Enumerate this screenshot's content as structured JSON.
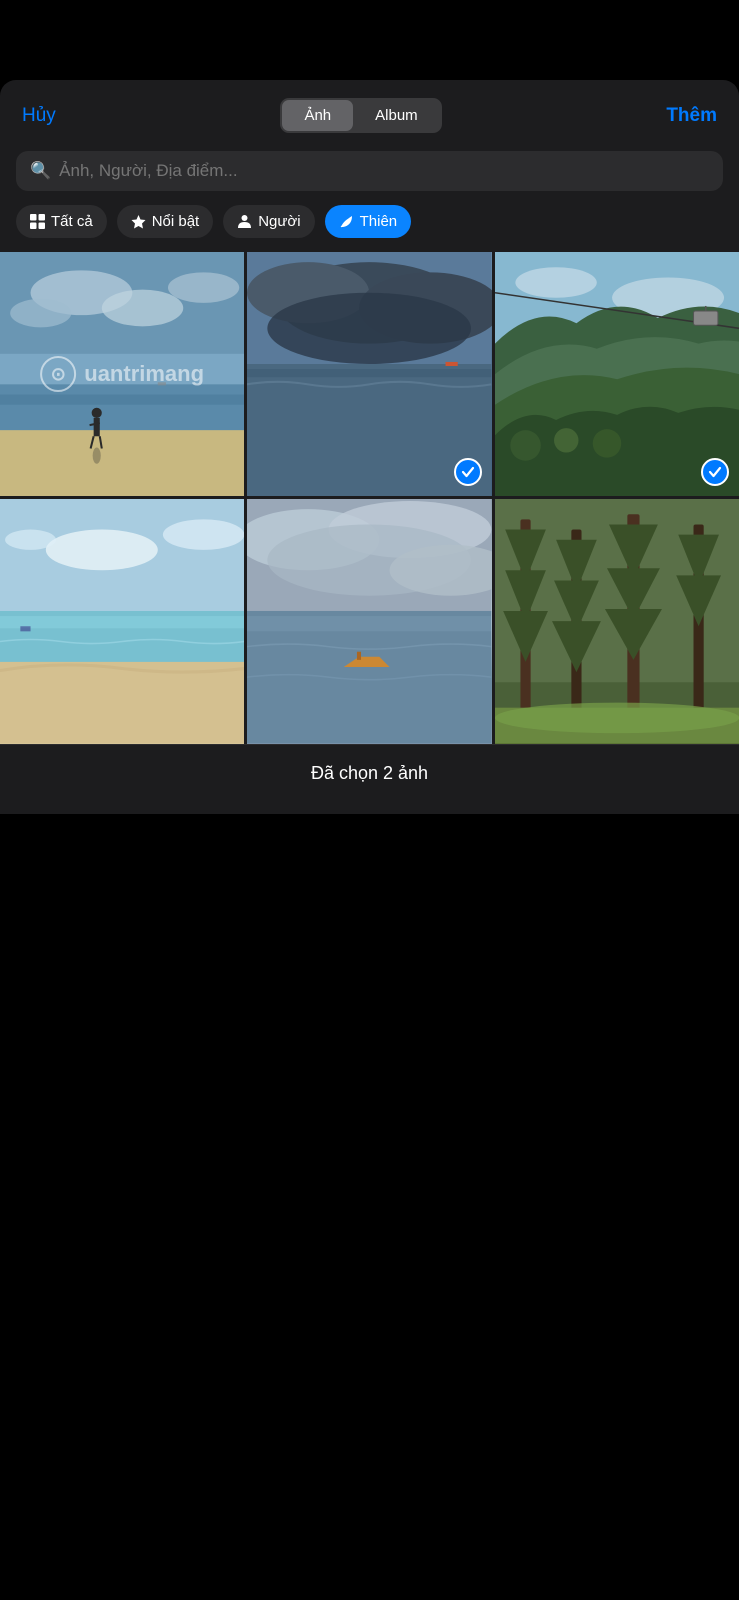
{
  "top_bar": {
    "cancel_label": "Hủy",
    "add_label": "Thêm",
    "segments": [
      {
        "id": "anh",
        "label": "Ảnh",
        "active": true
      },
      {
        "id": "album",
        "label": "Album",
        "active": false
      }
    ]
  },
  "search": {
    "placeholder": "Ảnh, Người, Địa điểm..."
  },
  "filter_tabs": [
    {
      "id": "tat-ca",
      "label": "Tất cả",
      "icon": "grid",
      "active": false
    },
    {
      "id": "noi-bat",
      "label": "Nổi bật",
      "icon": "star",
      "active": false
    },
    {
      "id": "nguoi",
      "label": "Người",
      "icon": "person",
      "active": false
    },
    {
      "id": "thien",
      "label": "Thiên",
      "icon": "leaf",
      "active": true
    }
  ],
  "photos": [
    {
      "id": 1,
      "style_class": "photo-beach1",
      "selected": false,
      "watermark": true
    },
    {
      "id": 2,
      "style_class": "photo-sea1",
      "selected": true,
      "watermark": false
    },
    {
      "id": 3,
      "style_class": "photo-mountain",
      "selected": true,
      "watermark": false
    },
    {
      "id": 4,
      "style_class": "photo-beach2",
      "selected": false,
      "watermark": false
    },
    {
      "id": 5,
      "style_class": "photo-cloudy",
      "selected": false,
      "watermark": false
    },
    {
      "id": 6,
      "style_class": "photo-forest",
      "selected": false,
      "watermark": false
    }
  ],
  "bottom": {
    "selection_label": "Đã chọn 2 ảnh"
  },
  "watermark": {
    "text": "uantrimang"
  }
}
